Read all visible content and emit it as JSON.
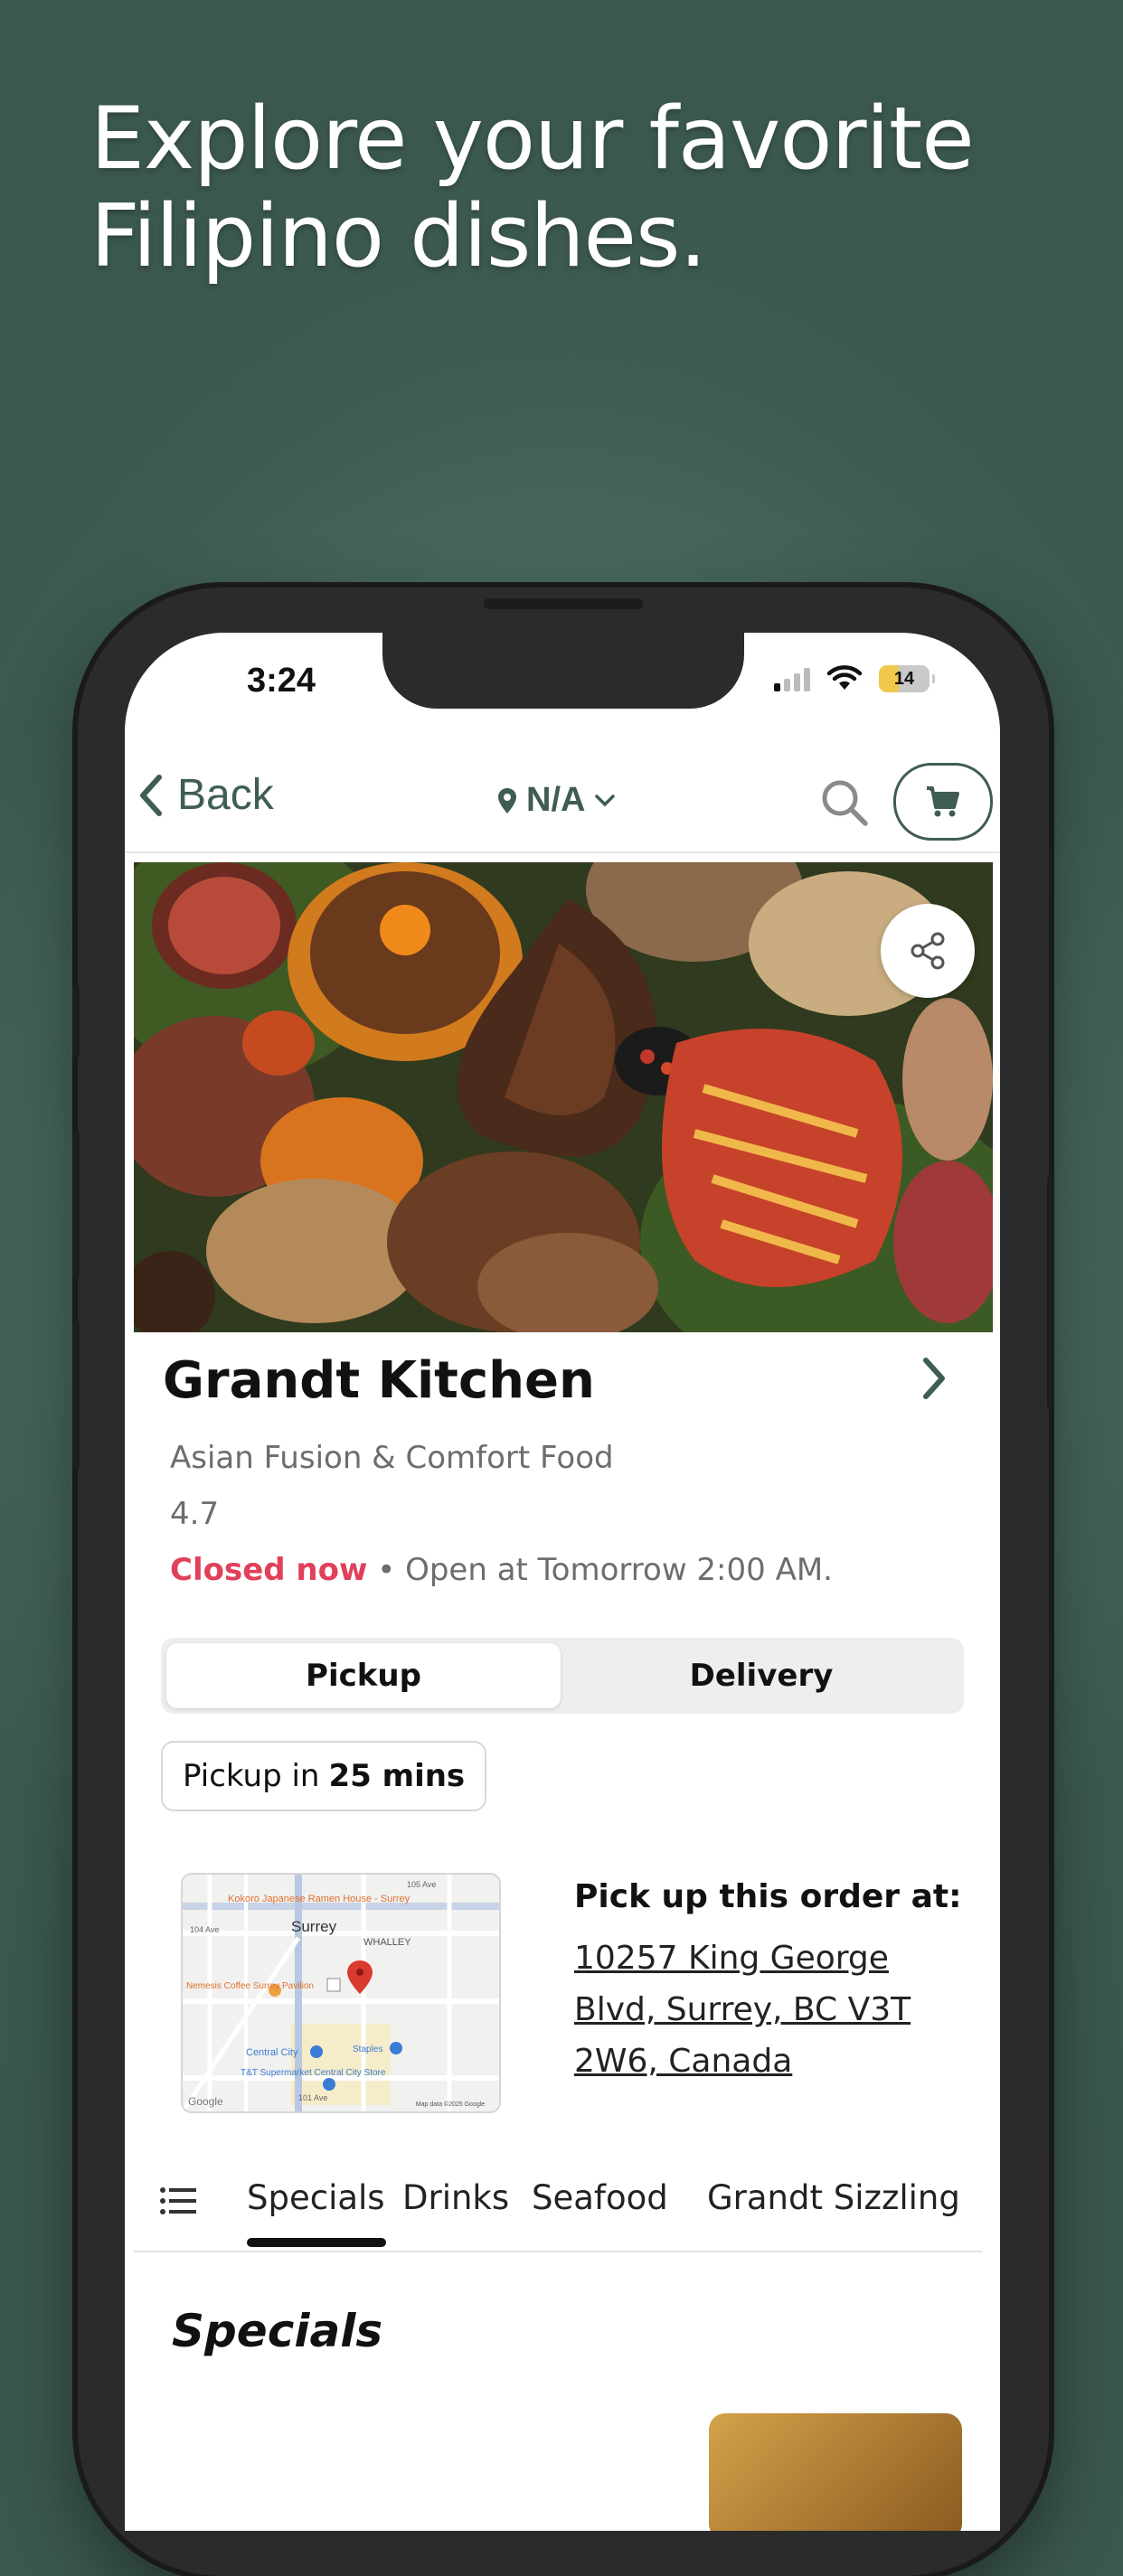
{
  "promo": {
    "headline": "Explore your favorite\nFilipino dishes."
  },
  "status_bar": {
    "time": "3:24",
    "battery": "14"
  },
  "nav": {
    "back_label": "Back",
    "location": "N/A"
  },
  "restaurant": {
    "name": "Grandt Kitchen",
    "category": "Asian Fusion & Comfort Food",
    "rating": "4.7",
    "status": "Closed now",
    "hours": " • Open at Tomorrow 2:00 AM."
  },
  "order_mode": {
    "options": [
      "Pickup",
      "Delivery"
    ],
    "selected": "Pickup"
  },
  "pickup": {
    "prefix": "Pickup in",
    "time": "25 mins"
  },
  "pickup_location": {
    "title": "Pick up this order at:",
    "address": "10257 King George Blvd, Surrey, BC V3T 2W6, Canada"
  },
  "map_labels": {
    "surrey": "Surrey",
    "whalley": "WHALLEY",
    "kokoro": "Kokoro Japanese Ramen House - Surrey",
    "nemesis": "Nemesis Coffee Surrey Pavilion",
    "central_city": "Central City",
    "tt": "T&T Supermarket Central City Store",
    "staples": "Staples",
    "ave_105": "105 Ave",
    "ave_104": "104 Ave",
    "ave_101": "101 Ave",
    "google": "Google",
    "map_data": "Map data ©2025 Google"
  },
  "menu_tabs": [
    "Specials",
    "Drinks",
    "Seafood",
    "Grandt Sizzling"
  ],
  "active_tab": "Specials",
  "section": {
    "title": "Specials"
  },
  "colors": {
    "brand_green": "#3f5d53",
    "closed_red": "#e0405a",
    "background": "#3b584e"
  }
}
